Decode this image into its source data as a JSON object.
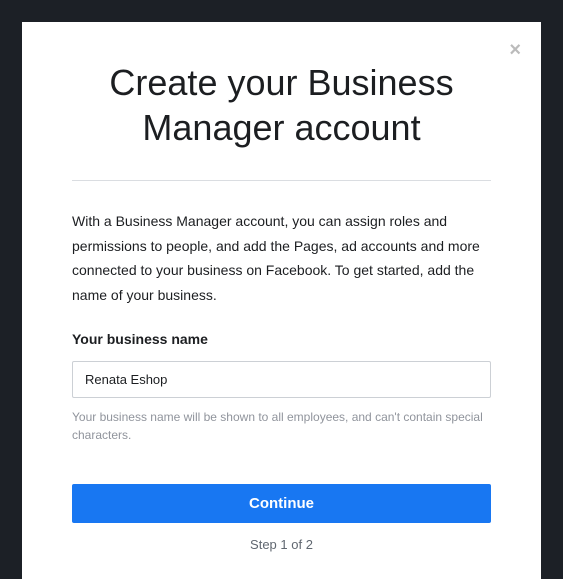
{
  "modal": {
    "title": "Create your Business Manager account",
    "description": "With a Business Manager account, you can assign roles and permissions to people, and add the Pages, ad accounts and more connected to your business on Facebook. To get started, add the name of your business.",
    "close_label": "×"
  },
  "form": {
    "business_name": {
      "label": "Your business name",
      "value": "Renata Eshop",
      "helper": "Your business name will be shown to all employees, and can't contain special characters."
    }
  },
  "actions": {
    "continue_label": "Continue",
    "step_indicator": "Step 1 of 2"
  }
}
